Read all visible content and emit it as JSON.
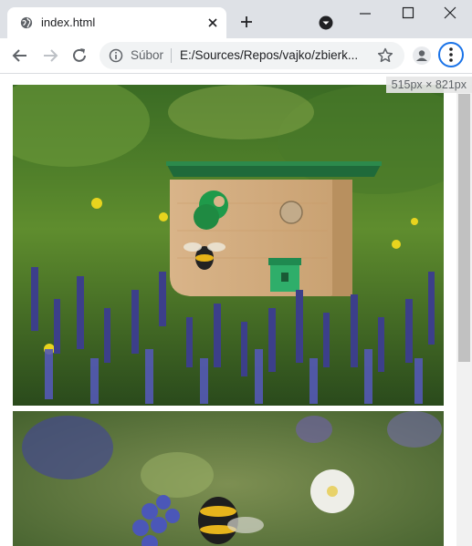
{
  "tab": {
    "title": "index.html"
  },
  "omnibox": {
    "scheme_label": "Súbor",
    "url": "E:/Sources/Repos/vajko/zbierk..."
  },
  "page": {
    "size_badge": "515px × 821px",
    "images": [
      {
        "description_icon": "bee-house-in-flowers-photo"
      },
      {
        "description_icon": "bumblebee-on-flower-photo"
      }
    ]
  },
  "colors": {
    "accent": "#1a73e8",
    "tabstrip": "#dee1e6",
    "omnibox": "#f1f3f4"
  }
}
